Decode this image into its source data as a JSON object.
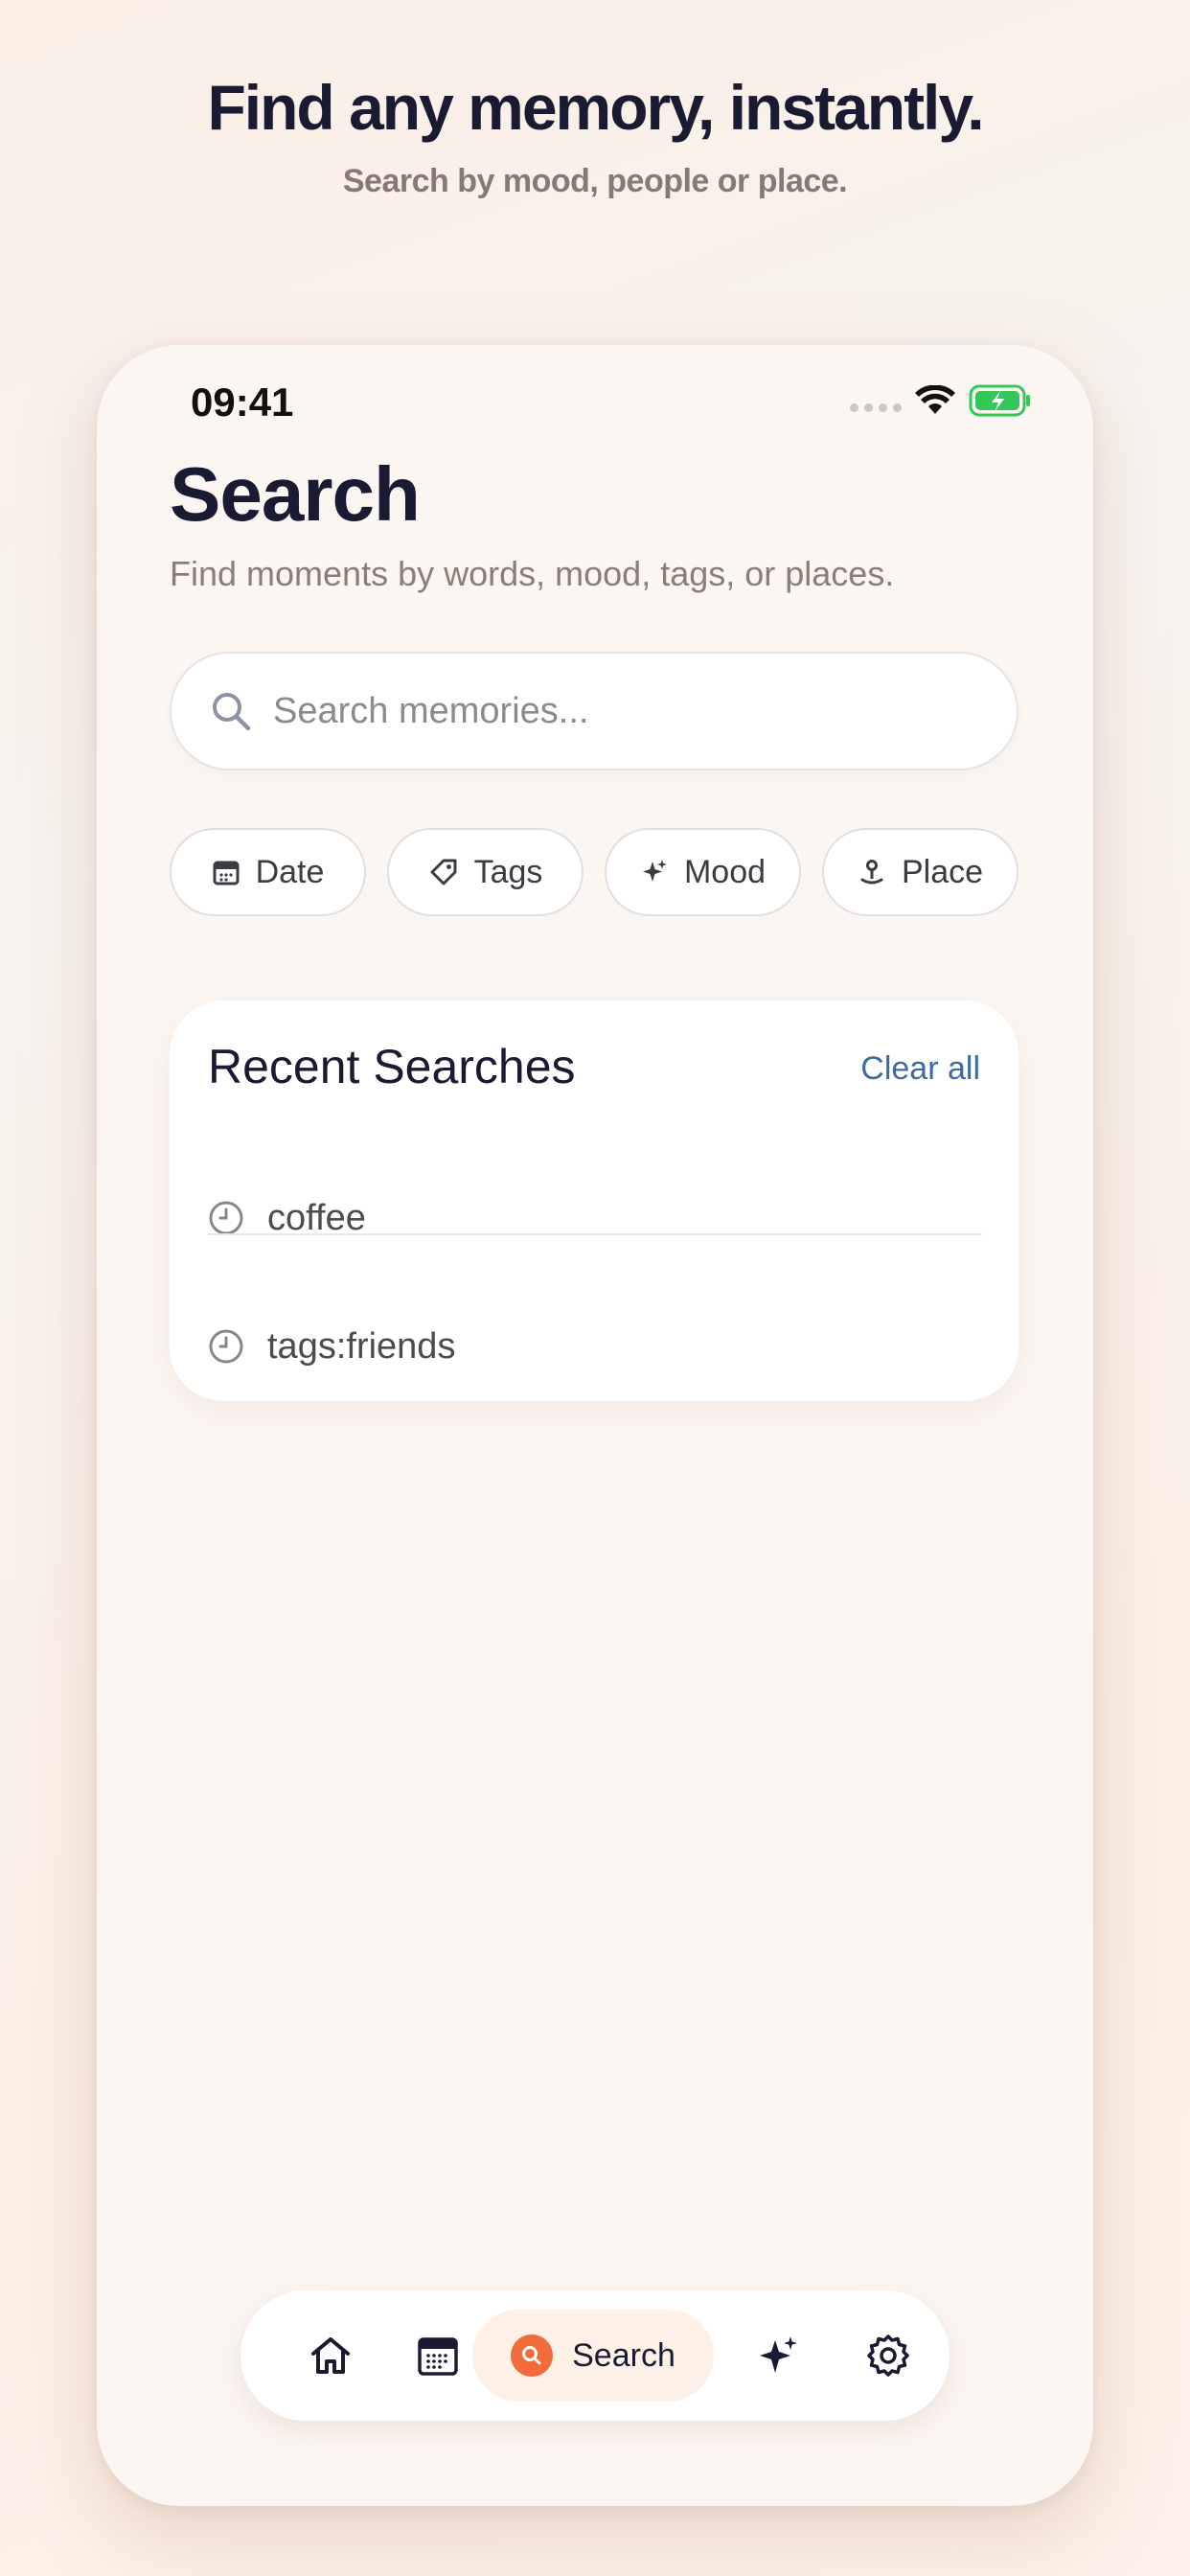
{
  "hero": {
    "title": "Find any memory, instantly.",
    "subtitle": "Search by mood, people or place."
  },
  "status_bar": {
    "time": "09:41",
    "battery_color": "#34c759"
  },
  "screen": {
    "title": "Search",
    "subtitle": "Find moments by words, mood, tags, or places."
  },
  "search": {
    "placeholder": "Search memories...",
    "value": ""
  },
  "filters": [
    {
      "label": "Date",
      "icon": "calendar-icon"
    },
    {
      "label": "Tags",
      "icon": "tag-icon"
    },
    {
      "label": "Mood",
      "icon": "sparkle-icon"
    },
    {
      "label": "Place",
      "icon": "pin-icon"
    }
  ],
  "recent": {
    "title": "Recent Searches",
    "clear_label": "Clear all",
    "items": [
      {
        "text": "coffee",
        "icon": "clock-icon"
      },
      {
        "text": "tags:friends",
        "icon": "clock-icon"
      }
    ]
  },
  "tabbar": {
    "active_label": "Search",
    "accent_color": "#f26b3a",
    "tabs": [
      "home-icon",
      "calendar-icon",
      "search-icon",
      "sparkle-icon",
      "gear-icon"
    ]
  }
}
